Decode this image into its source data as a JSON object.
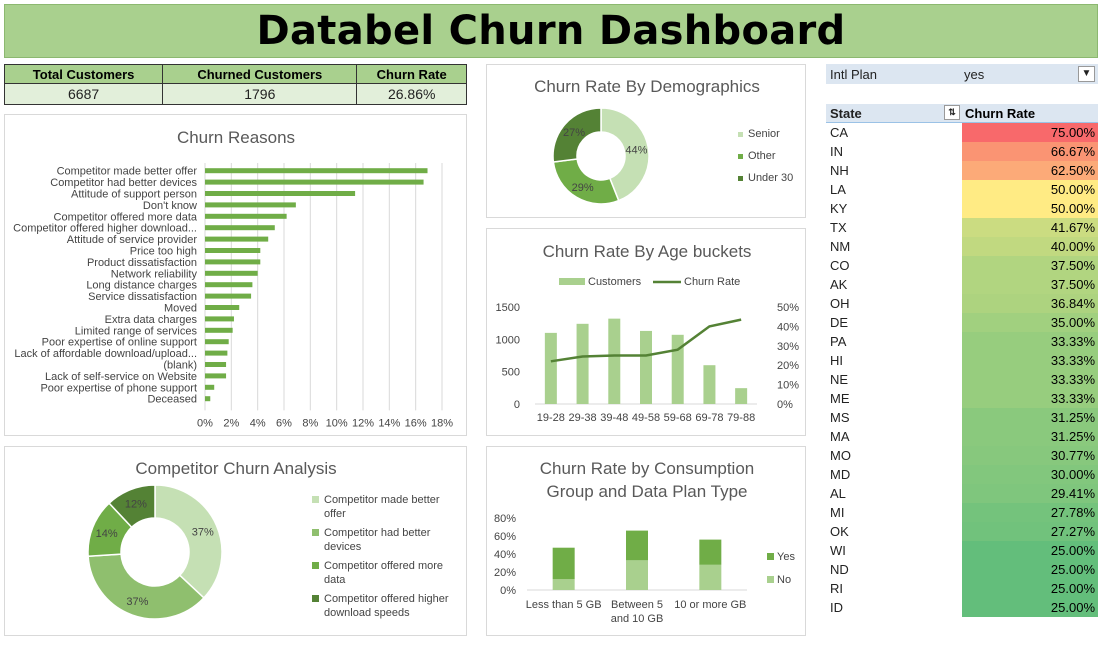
{
  "title": "Databel Churn Dashboard",
  "kpis": {
    "headers": [
      "Total Customers",
      "Churned Customers",
      "Churn Rate"
    ],
    "values": [
      "6687",
      "1796",
      "26.86%"
    ]
  },
  "colors": {
    "dark": "#548235",
    "mid": "#70ad47",
    "light": "#a9d08e",
    "pale": "#c5e0b4",
    "title_bg": "#a9d08e"
  },
  "slicer": {
    "label": "Intl Plan",
    "value": "yes",
    "filter_icon": "filter-icon"
  },
  "state_table": {
    "header_state": "State",
    "header_rate": "Churn Rate",
    "rows": [
      [
        "CA",
        "75.00%"
      ],
      [
        "IN",
        "66.67%"
      ],
      [
        "NH",
        "62.50%"
      ],
      [
        "LA",
        "50.00%"
      ],
      [
        "KY",
        "50.00%"
      ],
      [
        "TX",
        "41.67%"
      ],
      [
        "NM",
        "40.00%"
      ],
      [
        "CO",
        "37.50%"
      ],
      [
        "AK",
        "37.50%"
      ],
      [
        "OH",
        "36.84%"
      ],
      [
        "DE",
        "35.00%"
      ],
      [
        "PA",
        "33.33%"
      ],
      [
        "HI",
        "33.33%"
      ],
      [
        "NE",
        "33.33%"
      ],
      [
        "ME",
        "33.33%"
      ],
      [
        "MS",
        "31.25%"
      ],
      [
        "MA",
        "31.25%"
      ],
      [
        "MO",
        "30.77%"
      ],
      [
        "MD",
        "30.00%"
      ],
      [
        "AL",
        "29.41%"
      ],
      [
        "MI",
        "27.78%"
      ],
      [
        "OK",
        "27.27%"
      ],
      [
        "WI",
        "25.00%"
      ],
      [
        "ND",
        "25.00%"
      ],
      [
        "RI",
        "25.00%"
      ],
      [
        "ID",
        "25.00%"
      ]
    ]
  },
  "chart_data": [
    {
      "id": "reasons",
      "type": "bar",
      "orientation": "horizontal",
      "title": "Churn Reasons",
      "categories": [
        "Competitor made better offer",
        "Competitor had better devices",
        "Attitude of support person",
        "Don't know",
        "Competitor offered more data",
        "Competitor offered higher download...",
        "Attitude of service provider",
        "Price too high",
        "Product dissatisfaction",
        "Network reliability",
        "Long distance charges",
        "Service dissatisfaction",
        "Moved",
        "Extra data charges",
        "Limited range of services",
        "Poor expertise of online support",
        "Lack of affordable download/upload...",
        "(blank)",
        "Lack of self-service on Website",
        "Poor expertise of phone support",
        "Deceased"
      ],
      "values": [
        16.9,
        16.6,
        11.4,
        6.9,
        6.2,
        5.3,
        4.8,
        4.2,
        4.2,
        4.0,
        3.6,
        3.5,
        2.6,
        2.2,
        2.1,
        1.8,
        1.7,
        1.6,
        1.6,
        0.7,
        0.4
      ],
      "xticks": [
        "0%",
        "2%",
        "4%",
        "6%",
        "8%",
        "10%",
        "12%",
        "14%",
        "16%",
        "18%"
      ],
      "xlim": [
        0,
        18
      ],
      "grid": true
    },
    {
      "id": "demographics",
      "type": "pie",
      "variant": "donut",
      "title": "Churn Rate By Demographics",
      "labels": [
        "Senior",
        "Other",
        "Under 30"
      ],
      "values": [
        44,
        29,
        27
      ],
      "value_labels": [
        "44%",
        "29%",
        "27%"
      ],
      "legend": "right"
    },
    {
      "id": "age",
      "type": "bar",
      "combo": "bar+line",
      "title": "Churn Rate By Age buckets",
      "categories": [
        "19-28",
        "29-38",
        "39-48",
        "49-58",
        "59-68",
        "69-78",
        "79-88"
      ],
      "series": [
        {
          "name": "Customers",
          "type": "bar",
          "values": [
            1100,
            1240,
            1320,
            1130,
            1070,
            600,
            245
          ]
        },
        {
          "name": "Churn Rate",
          "type": "line",
          "axis": "right",
          "values": [
            22,
            24.5,
            25,
            25,
            28,
            40,
            43.5
          ]
        }
      ],
      "yticks_left": [
        "0",
        "500",
        "1000",
        "1500"
      ],
      "ylim_left": [
        0,
        1500
      ],
      "yticks_right": [
        "0%",
        "10%",
        "20%",
        "30%",
        "40%",
        "50%"
      ],
      "ylim_right": [
        0,
        50
      ],
      "legend": "top"
    },
    {
      "id": "competitor",
      "type": "pie",
      "variant": "donut",
      "title": "Competitor Churn Analysis",
      "labels": [
        "Competitor made better offer",
        "Competitor had better devices",
        "Competitor offered more data",
        "Competitor offered higher download speeds"
      ],
      "values": [
        37,
        37,
        14,
        12
      ],
      "value_labels": [
        "37%",
        "37%",
        "14%",
        "12%"
      ],
      "legend": "right"
    },
    {
      "id": "consumption",
      "type": "bar",
      "stacked": true,
      "title": "Churn Rate by Consumption Group and Data Plan Type",
      "title_lines": [
        "Churn Rate by Consumption",
        "Group and Data Plan Type"
      ],
      "categories": [
        "Less than 5 GB",
        "Between 5 and 10 GB",
        "10 or more GB"
      ],
      "category_lines": [
        [
          "Less than 5 GB"
        ],
        [
          "Between 5",
          "and 10 GB"
        ],
        [
          "10 or more GB"
        ]
      ],
      "series": [
        {
          "name": "No",
          "values": [
            12,
            33,
            28
          ]
        },
        {
          "name": "Yes",
          "values": [
            35,
            33,
            28
          ]
        }
      ],
      "yticks": [
        "0%",
        "20%",
        "40%",
        "60%",
        "80%"
      ],
      "ylim": [
        0,
        80
      ],
      "legend": "right"
    }
  ]
}
